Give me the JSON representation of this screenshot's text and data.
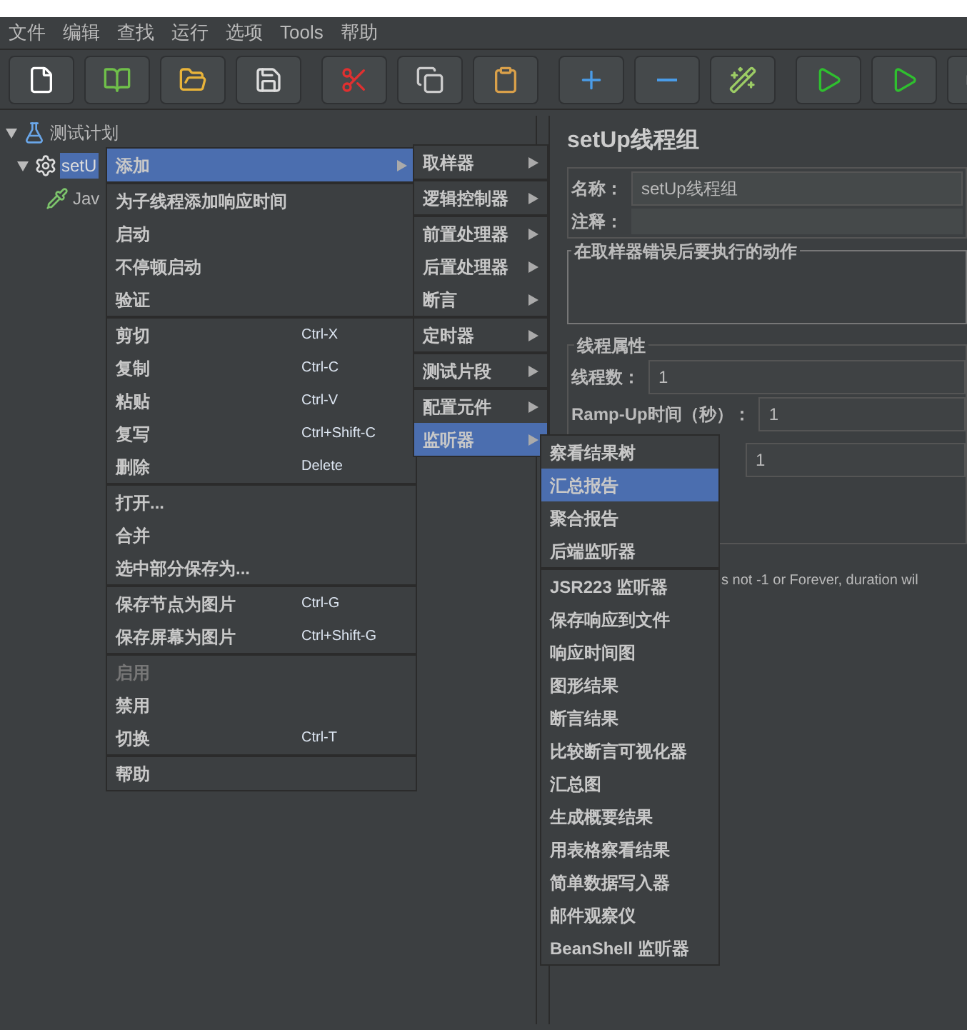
{
  "menubar": [
    {
      "label": "文件"
    },
    {
      "label": "编辑"
    },
    {
      "label": "查找"
    },
    {
      "label": "运行"
    },
    {
      "label": "选项"
    },
    {
      "label": "Tools"
    },
    {
      "label": "帮助"
    }
  ],
  "tree": [
    {
      "label": "测试计划",
      "kind": "plan",
      "expanded": true,
      "selected": false,
      "children": [
        {
          "label": "setU",
          "kind": "group",
          "expanded": true,
          "selected": true,
          "children": [
            {
              "label": "Jav",
              "kind": "sampler",
              "selected": false
            }
          ]
        }
      ]
    }
  ],
  "context_menu": {
    "groups": [
      [
        {
          "label": "添加",
          "submenu": true,
          "selected": true,
          "disabled": false
        }
      ],
      [
        {
          "label": "为子线程添加响应时间",
          "selected": false,
          "disabled": false
        },
        {
          "label": "启动",
          "selected": false,
          "disabled": false
        },
        {
          "label": "不停顿启动",
          "selected": false,
          "disabled": false
        },
        {
          "label": "验证",
          "selected": false,
          "disabled": false
        }
      ],
      [
        {
          "label": "剪切",
          "shortcut": "Ctrl-X",
          "selected": false,
          "disabled": false
        },
        {
          "label": "复制",
          "shortcut": "Ctrl-C",
          "selected": false,
          "disabled": false
        },
        {
          "label": "粘贴",
          "shortcut": "Ctrl-V",
          "selected": false,
          "disabled": false
        },
        {
          "label": "复写",
          "shortcut": "Ctrl+Shift-C",
          "selected": false,
          "disabled": false
        },
        {
          "label": "删除",
          "shortcut": "Delete",
          "selected": false,
          "disabled": false
        }
      ],
      [
        {
          "label": "打开...",
          "selected": false,
          "disabled": false
        },
        {
          "label": "合并",
          "selected": false,
          "disabled": false
        },
        {
          "label": "选中部分保存为...",
          "selected": false,
          "disabled": false
        }
      ],
      [
        {
          "label": "保存节点为图片",
          "shortcut": "Ctrl-G",
          "selected": false,
          "disabled": false
        },
        {
          "label": "保存屏幕为图片",
          "shortcut": "Ctrl+Shift-G",
          "selected": false,
          "disabled": false
        }
      ],
      [
        {
          "label": "启用",
          "selected": false,
          "disabled": true
        },
        {
          "label": "禁用",
          "selected": false,
          "disabled": false
        },
        {
          "label": "切换",
          "shortcut": "Ctrl-T",
          "selected": false,
          "disabled": false
        }
      ],
      [
        {
          "label": "帮助",
          "selected": false,
          "disabled": false
        }
      ]
    ]
  },
  "add_submenu": {
    "groups": [
      [
        {
          "label": "取样器",
          "submenu": true,
          "selected": false
        }
      ],
      [
        {
          "label": "逻辑控制器",
          "submenu": true,
          "selected": false
        }
      ],
      [
        {
          "label": "前置处理器",
          "submenu": true,
          "selected": false
        },
        {
          "label": "后置处理器",
          "submenu": true,
          "selected": false
        },
        {
          "label": "断言",
          "submenu": true,
          "selected": false
        }
      ],
      [
        {
          "label": "定时器",
          "submenu": true,
          "selected": false
        }
      ],
      [
        {
          "label": "测试片段",
          "submenu": true,
          "selected": false
        }
      ],
      [
        {
          "label": "配置元件",
          "submenu": true,
          "selected": false
        },
        {
          "label": "监听器",
          "submenu": true,
          "selected": true
        }
      ]
    ]
  },
  "listener_submenu": {
    "groups": [
      [
        {
          "label": "察看结果树",
          "selected": false
        },
        {
          "label": "汇总报告",
          "selected": true
        },
        {
          "label": "聚合报告",
          "selected": false
        },
        {
          "label": "后端监听器",
          "selected": false
        }
      ],
      [
        {
          "label": "JSR223 监听器",
          "selected": false
        },
        {
          "label": "保存响应到文件",
          "selected": false
        },
        {
          "label": "响应时间图",
          "selected": false
        },
        {
          "label": "图形结果",
          "selected": false
        },
        {
          "label": "断言结果",
          "selected": false
        },
        {
          "label": "比较断言可视化器",
          "selected": false
        },
        {
          "label": "汇总图",
          "selected": false
        },
        {
          "label": "生成概要结果",
          "selected": false
        },
        {
          "label": "用表格察看结果",
          "selected": false
        },
        {
          "label": "简单数据写入器",
          "selected": false
        },
        {
          "label": "邮件观察仪",
          "selected": false
        },
        {
          "label": "BeanShell 监听器",
          "selected": false
        }
      ]
    ]
  },
  "panel": {
    "title": "setUp线程组",
    "name_label": "名称：",
    "name_value": "setUp线程组",
    "comment_label": "注释：",
    "error_action_title": "在取样器错误后要执行的动作",
    "thread_props_title": "线程属性",
    "threads_label": "线程数：",
    "threads_value": "1",
    "rampup_label": "Ramp-Up时间（秒）：",
    "rampup_value": "1",
    "loop_value": "1",
    "note": "s not -1 or Forever, duration wil"
  }
}
